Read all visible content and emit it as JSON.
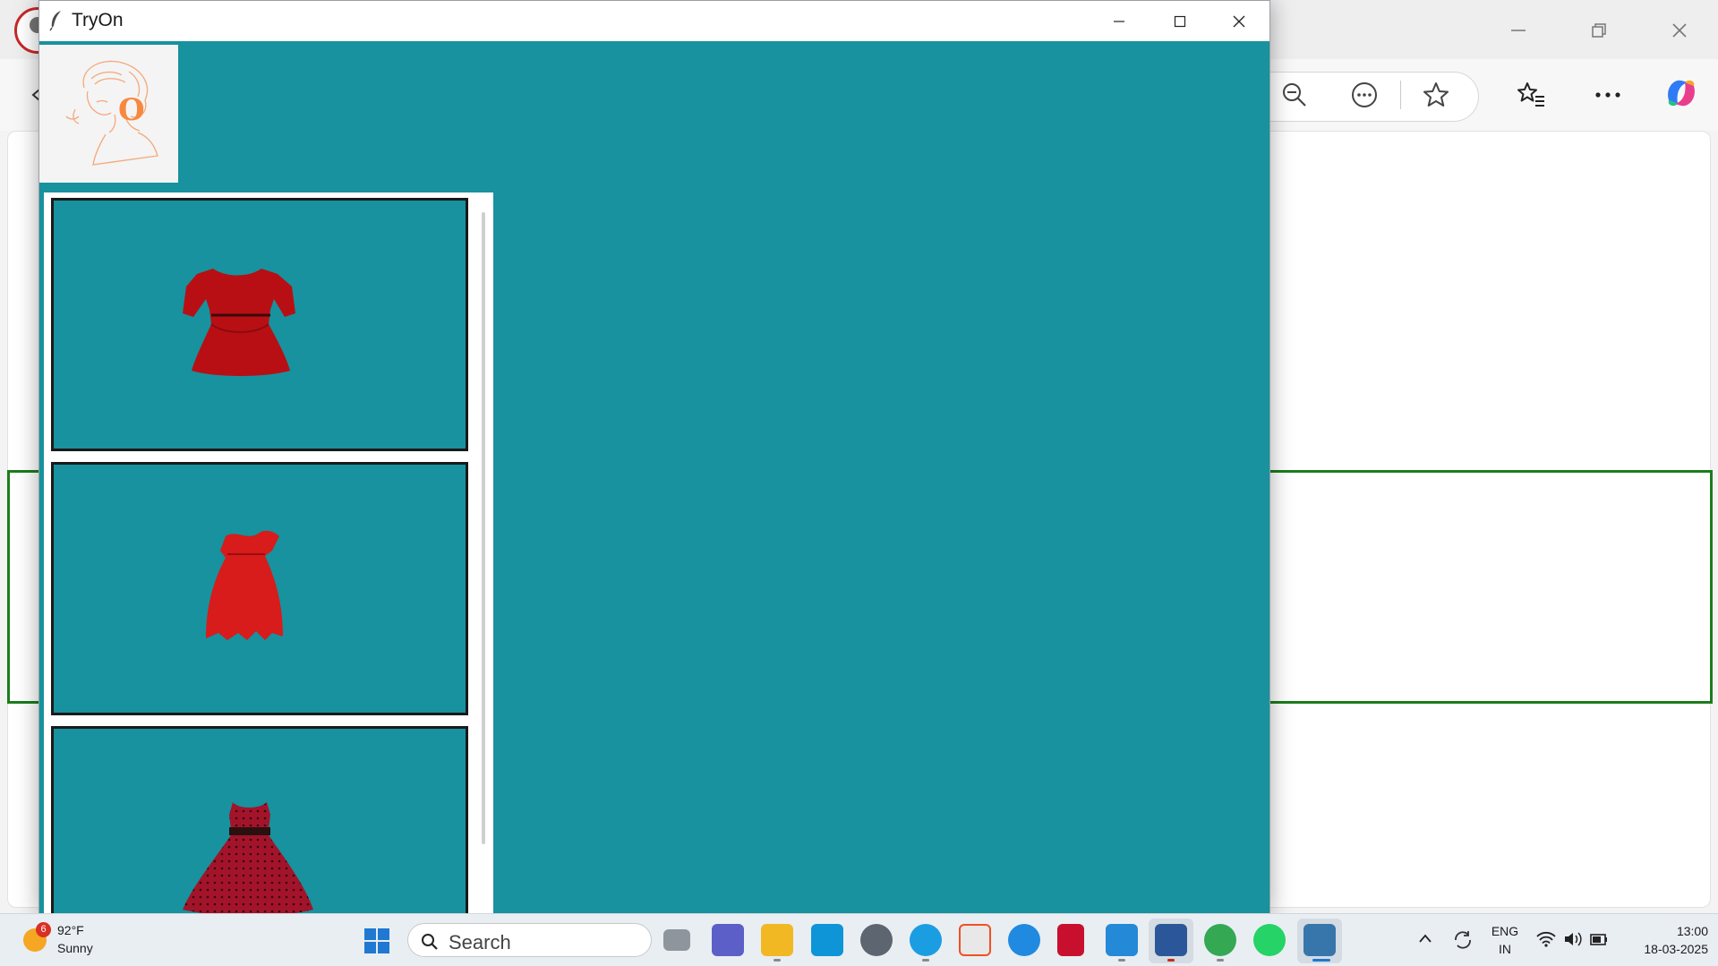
{
  "app": {
    "title": "TryOn",
    "window_controls": {
      "minimize": "minimize-icon",
      "maximize": "maximize-icon",
      "close": "close-icon"
    },
    "logo": {
      "letter": "O"
    },
    "wardrobe": {
      "items": [
        {
          "name": "red lace dress with sleeves",
          "color": "#b80f14"
        },
        {
          "name": "red off-shoulder dress",
          "color": "#d81b1b"
        },
        {
          "name": "red polka dot flared dress",
          "color": "#a3142a"
        }
      ]
    }
  },
  "browser": {
    "toolbar_icons": [
      "zoom-out-icon",
      "more-tools-icon",
      "favorite-star-icon",
      "favorites-list-icon",
      "ellipsis-icon",
      "copilot-icon"
    ]
  },
  "taskbar": {
    "weather": {
      "temp": "92°F",
      "desc": "Sunny",
      "badge": "6"
    },
    "search_placeholder": "Search",
    "apps": [
      "task-view",
      "teams",
      "file-explorer",
      "myhp",
      "clock",
      "edge",
      "store",
      "help",
      "mcafee",
      "vscode",
      "word",
      "chrome",
      "whatsapp",
      "python"
    ],
    "tray": {
      "lang_top": "ENG",
      "lang_bottom": "IN",
      "time": "13:00",
      "date": "18-03-2025"
    }
  },
  "colors": {
    "app_bg": "#17929e",
    "green_outline": "#1c7c1c"
  }
}
